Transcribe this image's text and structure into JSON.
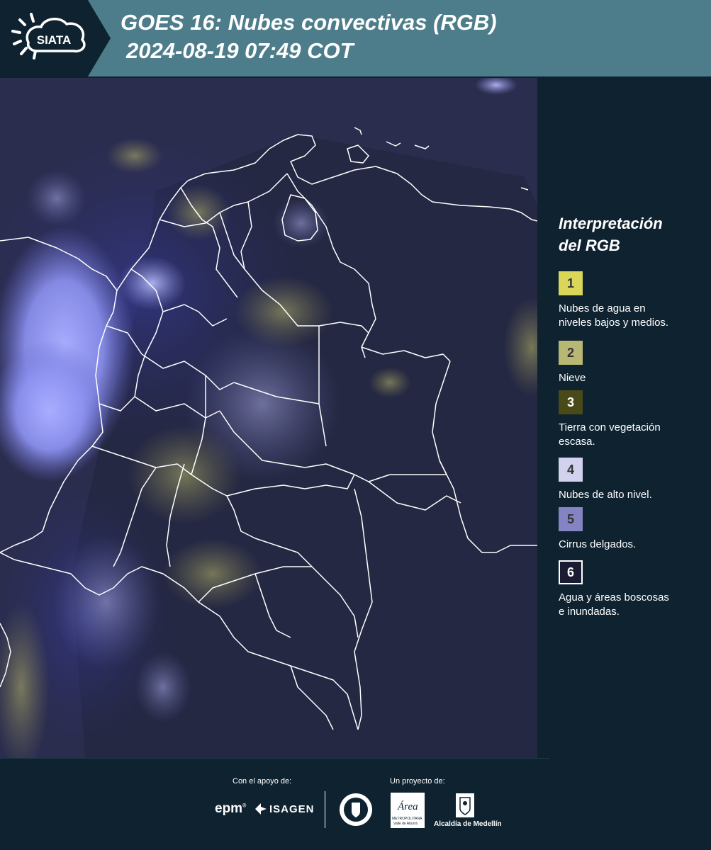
{
  "header": {
    "logo_text": "SIATA",
    "title_line1": "GOES 16: Nubes convectivas (RGB)",
    "title_line2": "2024-08-19 07:49 COT"
  },
  "legend": {
    "title_line1": "Interpretación",
    "title_line2": "del RGB",
    "items": [
      {
        "num": "1",
        "line1": "Nubes de agua en",
        "line2": "niveles bajos y medios.",
        "color": "#d9d65a"
      },
      {
        "num": "2",
        "line1": "Nieve",
        "line2": "",
        "color": "#b8b774"
      },
      {
        "num": "3",
        "line1": "Tierra con vegetación",
        "line2": "escasa.",
        "color": "#4a4a18"
      },
      {
        "num": "4",
        "line1": "Nubes de alto nivel.",
        "line2": "",
        "color": "#d2d2ee"
      },
      {
        "num": "5",
        "line1": "Cirrus delgados.",
        "line2": "",
        "color": "#8484c4"
      },
      {
        "num": "6",
        "line1": "Agua y áreas boscosas",
        "line2": "e inundadas.",
        "color": "#1b1b33"
      }
    ]
  },
  "footer": {
    "support_label": "Con el apoyo de:",
    "project_label": "Un proyecto de:",
    "epm": "epm",
    "isagen": "ISAGEN",
    "area_name": "Área",
    "area_sub": "METROPOLITANA",
    "area_sub2": "Valle de Aburrá",
    "alcaldia": "Alcaldía de Medellín"
  },
  "colors": {
    "header_bg": "#4d7d8a",
    "page_bg": "#0e2230",
    "map_bg": "#2b2d4f"
  }
}
